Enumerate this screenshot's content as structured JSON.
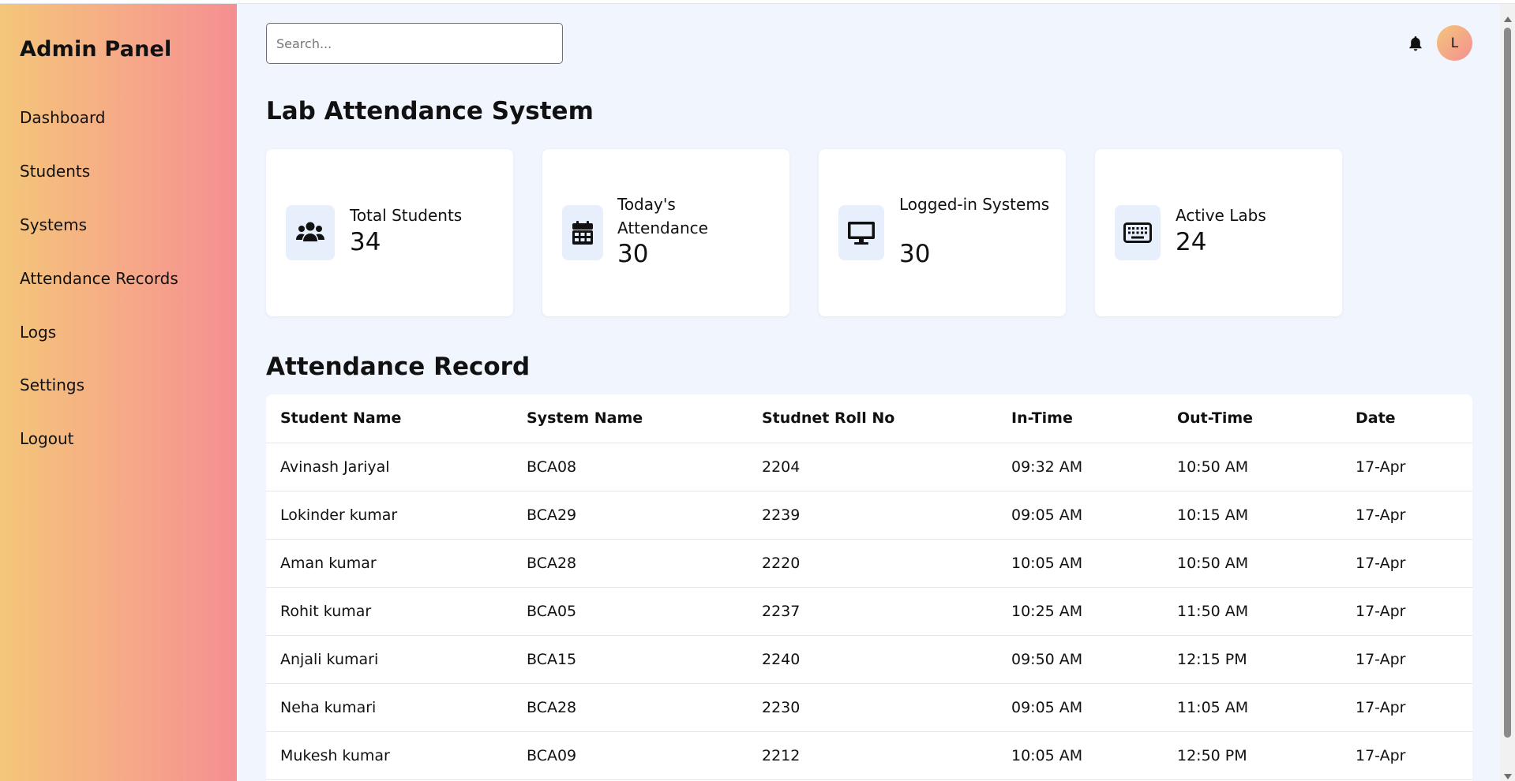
{
  "sidebar": {
    "brand": "Admin Panel",
    "items": [
      {
        "label": "Dashboard"
      },
      {
        "label": "Students"
      },
      {
        "label": "Systems"
      },
      {
        "label": "Attendance Records"
      },
      {
        "label": "Logs"
      },
      {
        "label": "Settings"
      },
      {
        "label": "Logout"
      }
    ]
  },
  "header": {
    "search_placeholder": "Search...",
    "search_value": "",
    "avatar_initial": "L",
    "bell_icon": "bell-icon"
  },
  "main": {
    "title": "Lab Attendance System",
    "cards": [
      {
        "label": "Total Students",
        "value": "34",
        "icon": "users-icon"
      },
      {
        "label": "Today's Attendance",
        "value": "30",
        "icon": "calendar-icon"
      },
      {
        "label": "Logged-in Systems",
        "value": "30",
        "icon": "monitor-icon"
      },
      {
        "label": "Active Labs",
        "value": "24",
        "icon": "keyboard-icon"
      }
    ],
    "section_title": "Attendance Record",
    "table": {
      "headers": [
        "Student Name",
        "System Name",
        "Studnet Roll No",
        "In-Time",
        "Out-Time",
        "Date"
      ],
      "rows": [
        [
          "Avinash Jariyal",
          "BCA08",
          "2204",
          "09:32 AM",
          "10:50 AM",
          "17-Apr"
        ],
        [
          "Lokinder kumar",
          "BCA29",
          "2239",
          "09:05 AM",
          "10:15 AM",
          "17-Apr"
        ],
        [
          "Aman kumar",
          "BCA28",
          "2220",
          "10:05 AM",
          "10:50 AM",
          "17-Apr"
        ],
        [
          "Rohit kumar",
          "BCA05",
          "2237",
          "10:25 AM",
          "11:50 AM",
          "17-Apr"
        ],
        [
          "Anjali kumari",
          "BCA15",
          "2240",
          "09:50 AM",
          "12:15 PM",
          "17-Apr"
        ],
        [
          "Neha kumari",
          "BCA28",
          "2230",
          "09:05 AM",
          "11:05 AM",
          "17-Apr"
        ],
        [
          "Mukesh kumar",
          "BCA09",
          "2212",
          "10:05 AM",
          "12:50 PM",
          "17-Apr"
        ]
      ]
    }
  },
  "colors": {
    "sidebar_gradient_start": "#f4c679",
    "sidebar_gradient_end": "#f58f92",
    "background": "#f1f5fd",
    "icon_tile": "#e7eefc"
  }
}
